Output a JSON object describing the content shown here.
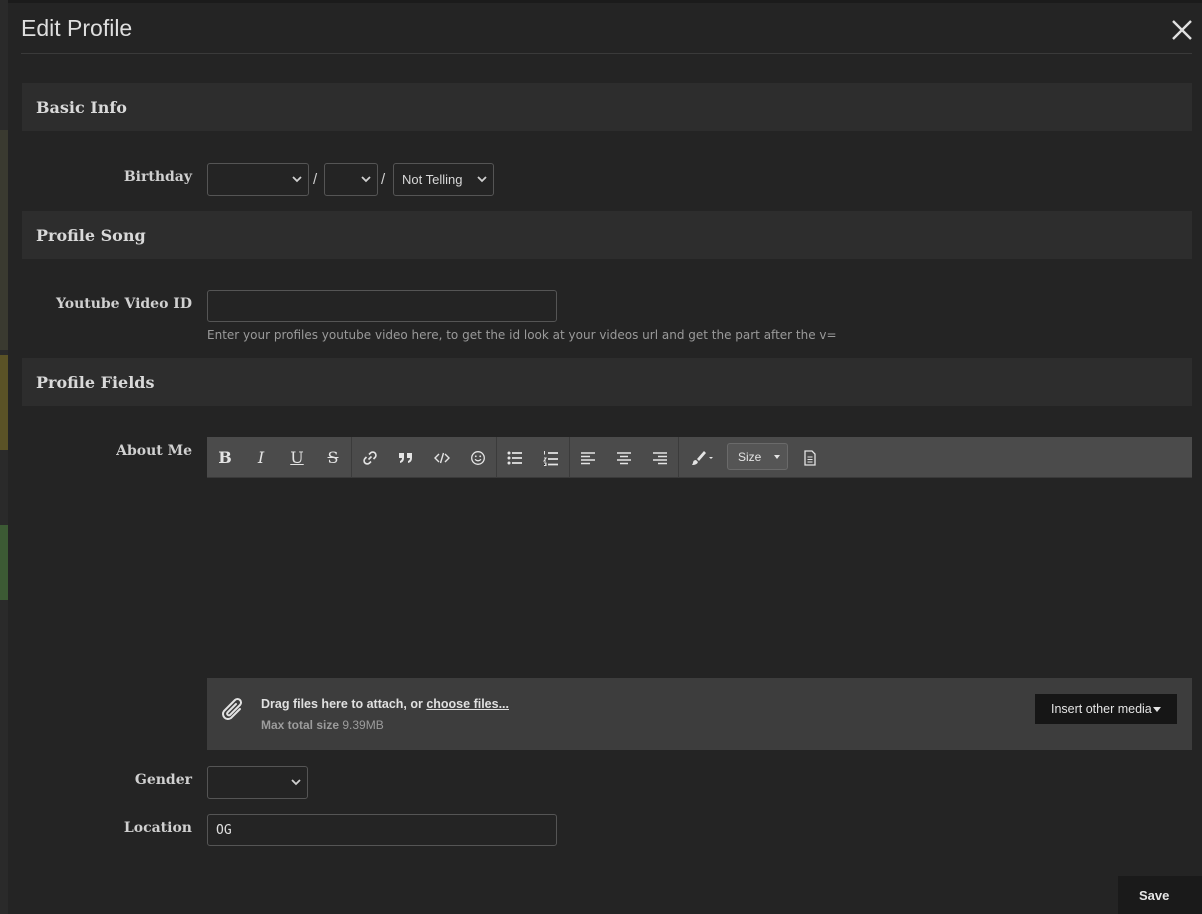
{
  "dialog": {
    "title": "Edit Profile"
  },
  "sections": {
    "basic_info": "Basic Info",
    "profile_song": "Profile Song",
    "profile_fields": "Profile Fields"
  },
  "birthday": {
    "label": "Birthday",
    "month_value": "",
    "day_value": "",
    "year_value": "Not Telling",
    "separator": "/"
  },
  "youtube": {
    "label": "Youtube Video ID",
    "value": "",
    "hint": "Enter your profiles youtube video here, to get the id look at your videos url and get the part after the v="
  },
  "about_me": {
    "label": "About Me",
    "toolbar": {
      "bold": "B",
      "italic": "I",
      "underline": "U",
      "strike": "S",
      "size_label": "Size",
      "icons": [
        "bold-icon",
        "italic-icon",
        "underline-icon",
        "strikethrough-icon",
        "link-icon",
        "quote-icon",
        "code-icon",
        "smiley-icon",
        "bullet-list-icon",
        "numbered-list-icon",
        "align-left-icon",
        "align-center-icon",
        "align-right-icon",
        "paint-brush-icon",
        "document-icon"
      ]
    },
    "attach": {
      "text": "Drag files here to attach, or ",
      "link": "choose files...",
      "max_label": "Max total size",
      "max_value": "9.39MB",
      "insert_media": "Insert other media"
    }
  },
  "gender": {
    "label": "Gender",
    "value": ""
  },
  "location": {
    "label": "Location",
    "value": "OG"
  },
  "save_label": "Save"
}
